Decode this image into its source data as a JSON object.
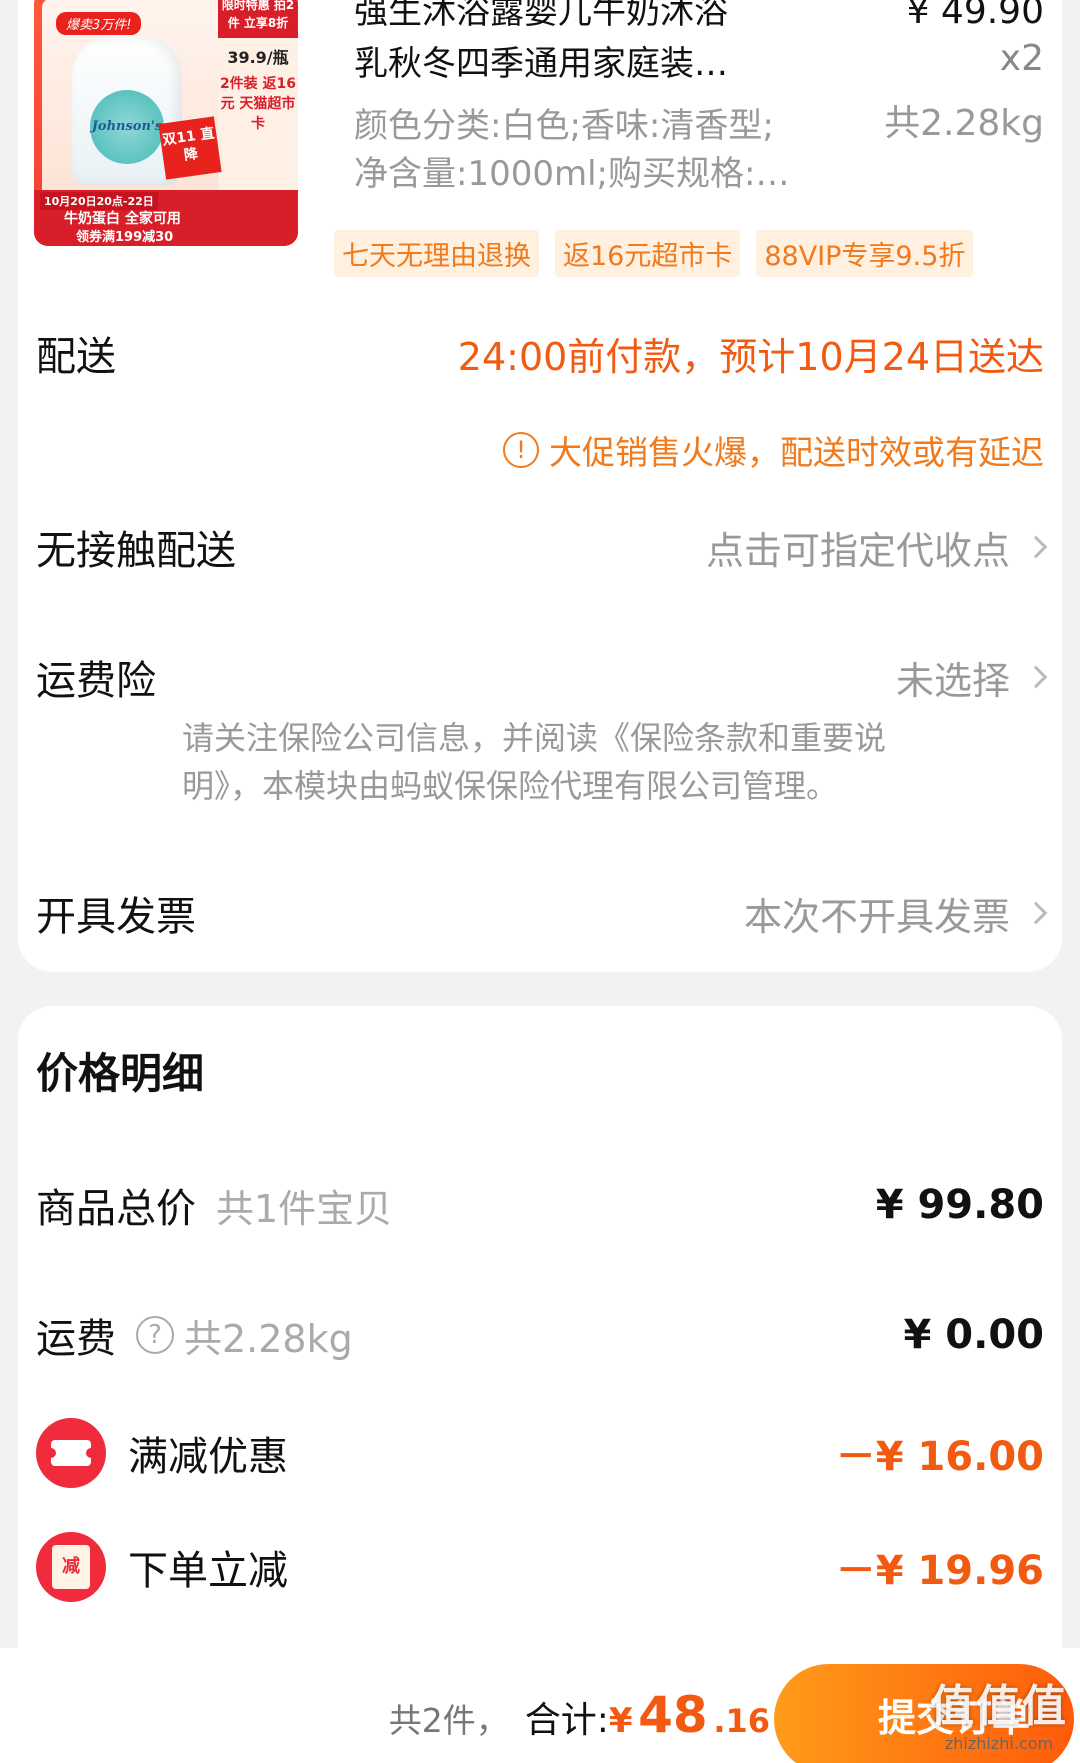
{
  "product": {
    "thumb": {
      "badge": "爆卖3万件!",
      "side_top": "限时特惠 拍2件 立享8折",
      "side_price": "39.9/瓶",
      "side_card": "2件装 返16元 天猫超市卡",
      "tag": "双11 直降",
      "strip_date": "10月20日20点-22日",
      "strip_main": "牛奶蛋白 全家可用",
      "strip_coupon": "领券满199减30",
      "brand": "Johnson's"
    },
    "title_line1": "强生沐浴露婴儿牛奶沐浴",
    "title_line2": "乳秋冬四季通用家庭装…",
    "price": "¥ 49.90",
    "qty": "x2",
    "weight": "共2.28kg",
    "spec_line1": "颜色分类:白色;香味:清香型;",
    "spec_line2": "净含量:1000ml;购买规格:…",
    "tags": [
      "七天无理由退换",
      "返16元超市卡",
      "88VIP专享9.5折"
    ]
  },
  "delivery": {
    "label": "配送",
    "value": "24:00前付款，预计10月24日送达",
    "warning": "大促销售火爆，配送时效或有延迟"
  },
  "contactless": {
    "label": "无接触配送",
    "value": "点击可指定代收点"
  },
  "insurance": {
    "label": "运费险",
    "value": "未选择",
    "note": "请关注保险公司信息，并阅读《保险条款和重要说明》，本模块由蚂蚁保保险代理有限公司管理。"
  },
  "invoice": {
    "label": "开具发票",
    "value": "本次不开具发票"
  },
  "price_detail": {
    "title": "价格明细",
    "goods_total_label": "商品总价",
    "goods_total_sub": "共1件宝贝",
    "goods_total": "¥ 99.80",
    "shipping_label": "运费",
    "shipping_sub": "共2.28kg",
    "shipping": "¥ 0.00",
    "full_discount_label": "满减优惠",
    "full_discount": "－¥ 16.00",
    "order_discount_label": "下单立减",
    "order_discount_icon_text": "减",
    "order_discount": "－¥ 19.96"
  },
  "footer": {
    "count": "共2件，",
    "total_label": "合计:",
    "currency": "¥",
    "total_int": "48",
    "total_dec": ".16",
    "submit": "提交订单",
    "watermark": "值值值",
    "watermark_url": "zhizhizhi.com"
  }
}
